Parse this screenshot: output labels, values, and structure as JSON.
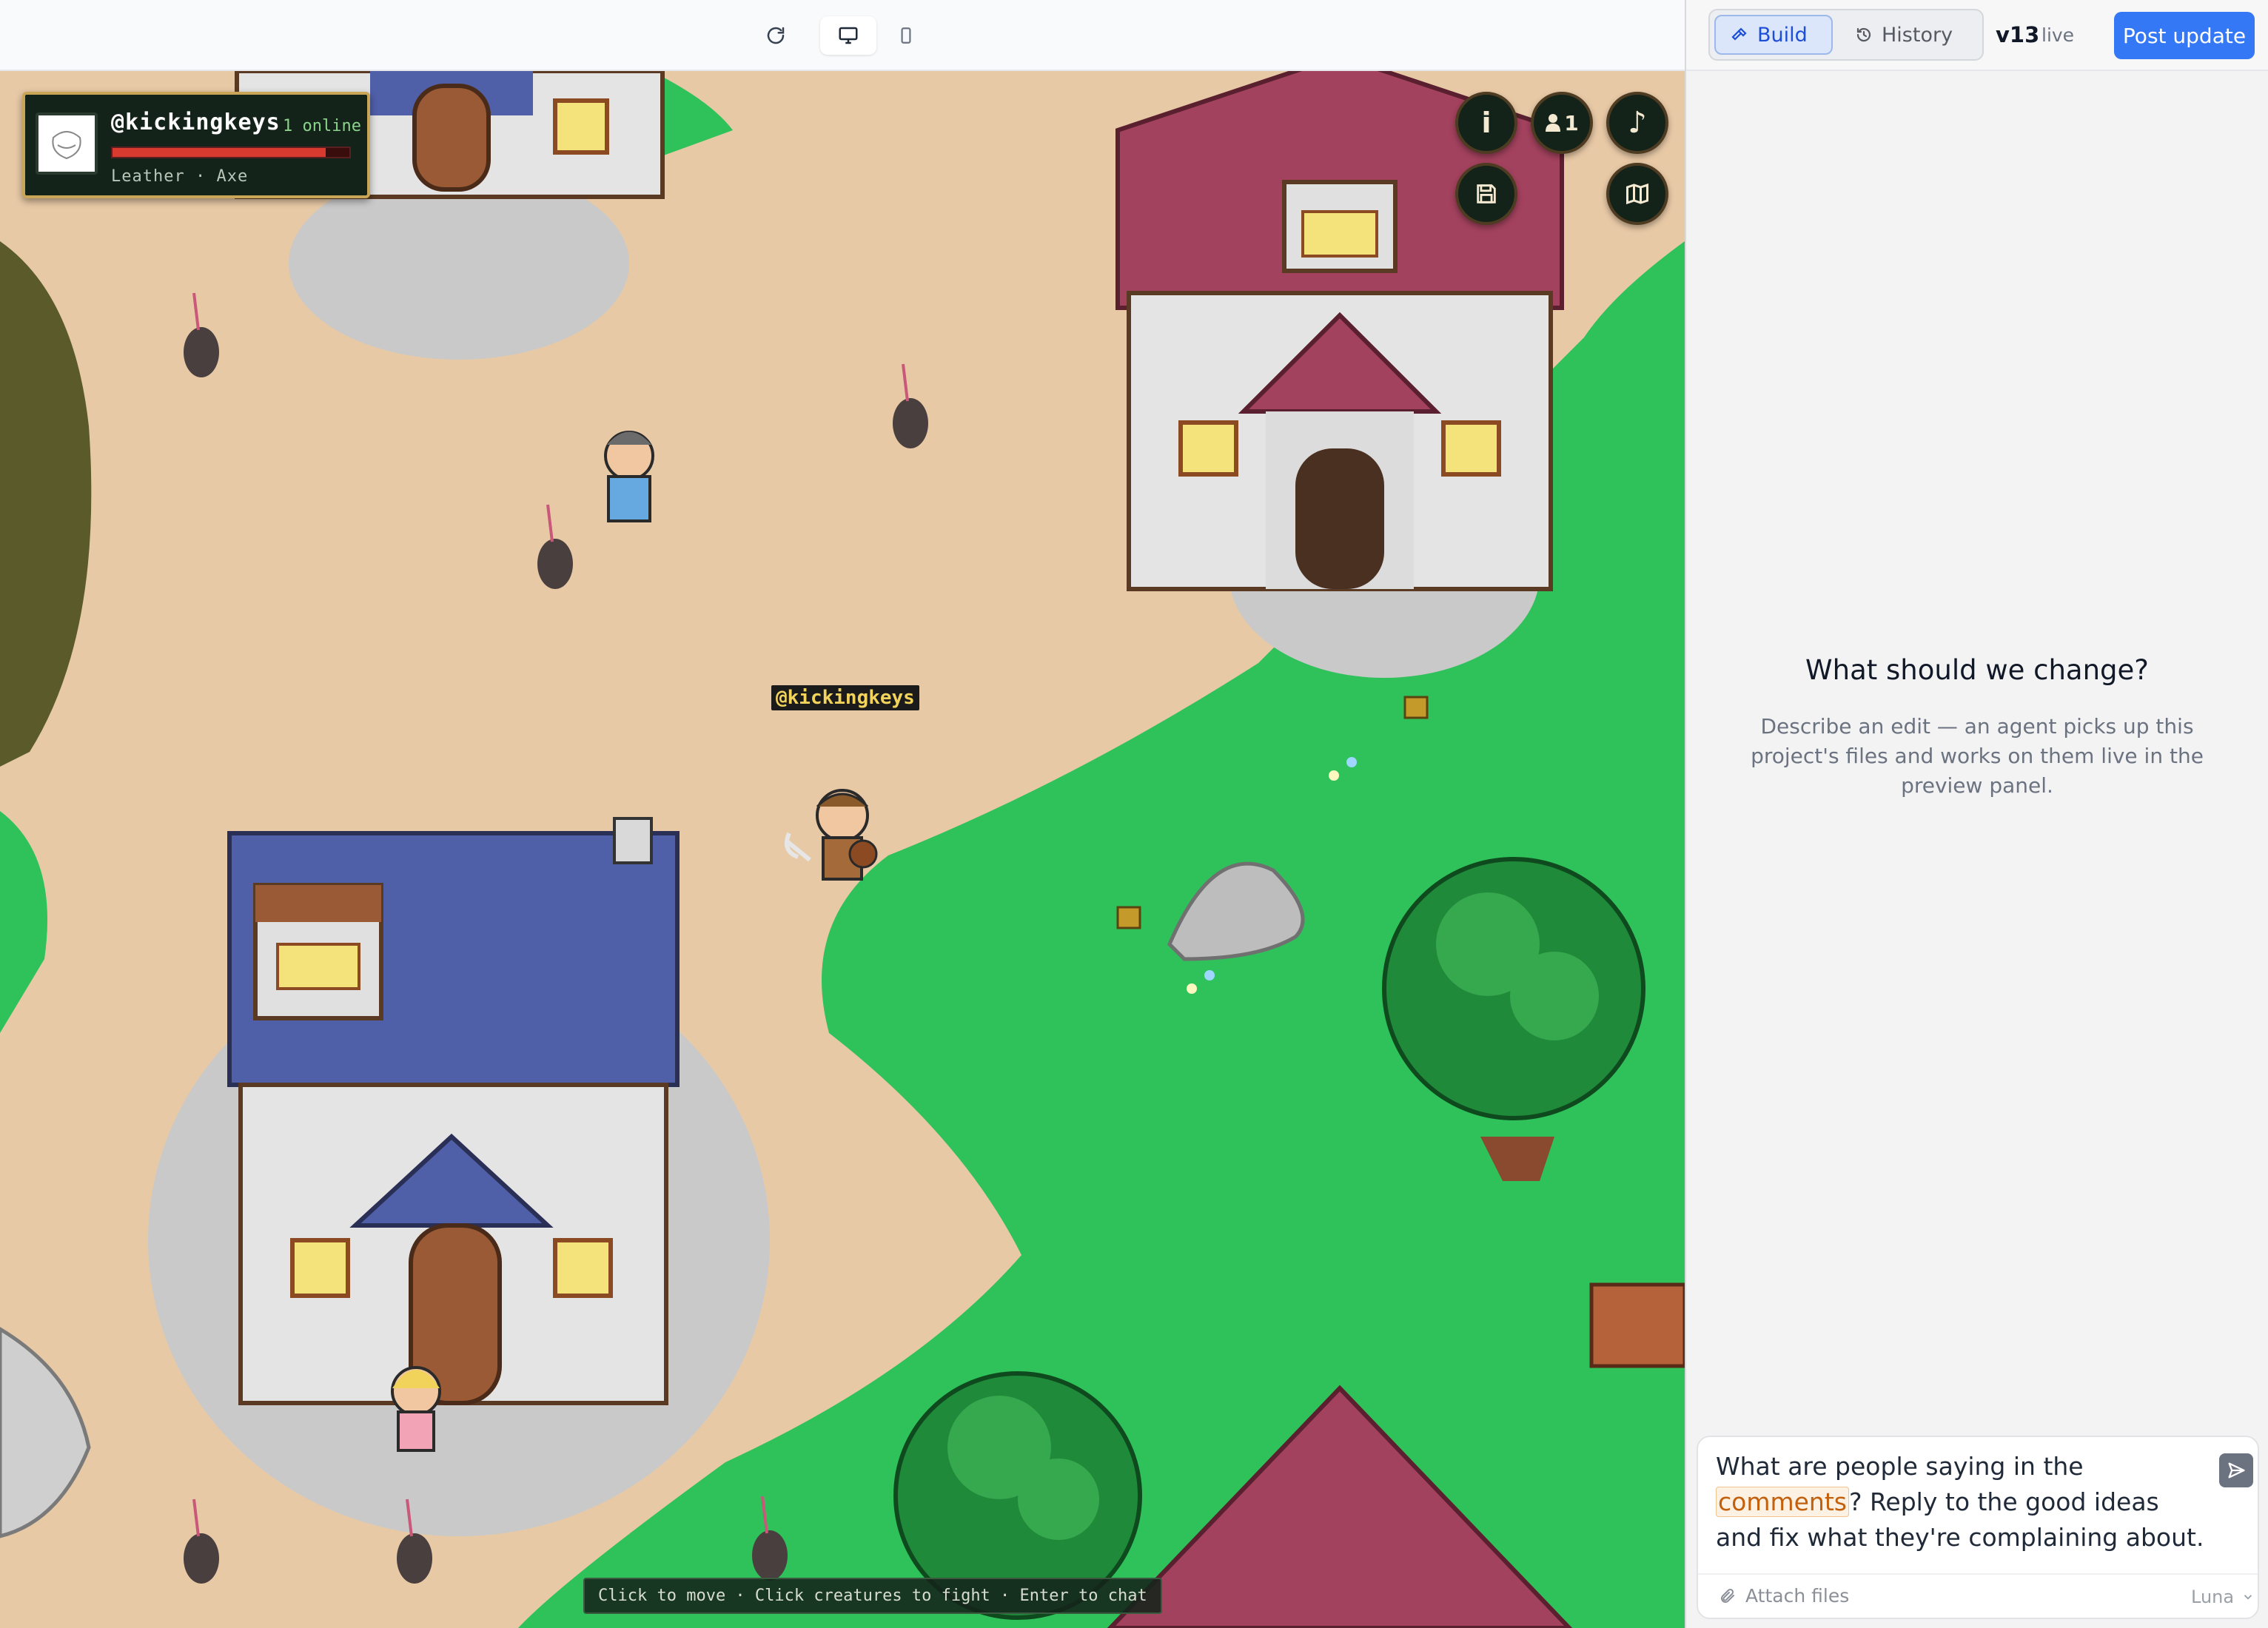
{
  "preview": {
    "toolbar": {
      "refresh_icon": "refresh-icon",
      "desktop_icon": "monitor-icon",
      "mobile_icon": "phone-icon"
    },
    "game": {
      "player": {
        "handle": "@kickingkeys",
        "online": "1 online",
        "health_fraction": 0.9,
        "gear": "Leather · Axe"
      },
      "buttons": {
        "info": "i",
        "players_count": "1",
        "music": "♪"
      },
      "player_nametag": "@kickingkeys",
      "hint": "Click to move · Click creatures to fight · Enter to chat",
      "colors": {
        "grass": "#2fc15a",
        "path": "#e8c9a6",
        "hud_border": "#c8a557"
      }
    }
  },
  "panel": {
    "tabs": {
      "build": "Build",
      "history": "History"
    },
    "version": "v13",
    "version_status": "live",
    "post_update": "Post update",
    "empty_state": {
      "title": "What should we change?",
      "description": "Describe an edit — an agent picks up this project's files and works on them live in the preview panel."
    },
    "composer": {
      "text_before": "What are people saying in the ",
      "mention": "comments",
      "text_after": "? Reply to the good ideas and fix what they're complaining about.",
      "attach": "Attach files",
      "model": "Luna"
    },
    "colors": {
      "accent": "#3578f6",
      "mention": "#c2600e"
    }
  }
}
